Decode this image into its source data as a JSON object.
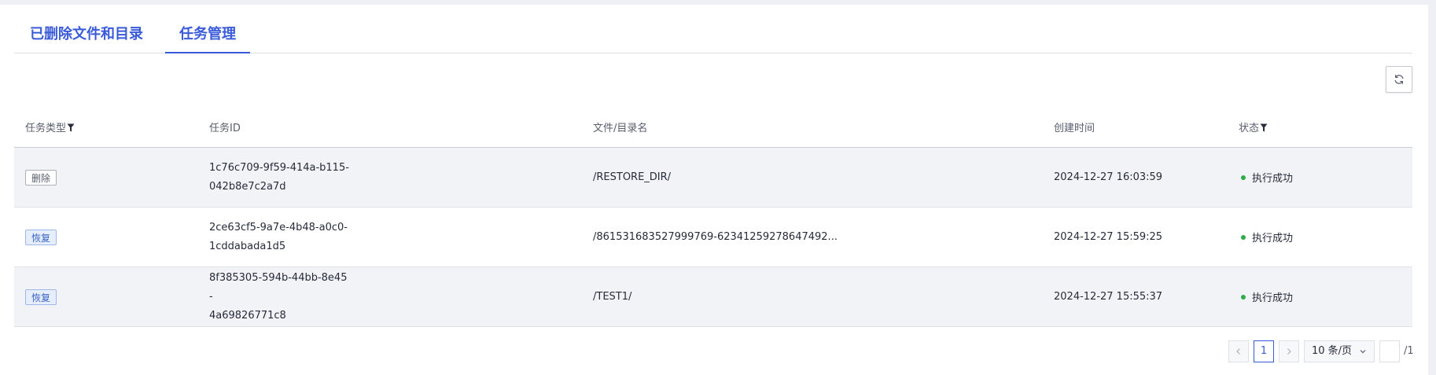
{
  "tabs": [
    {
      "label": "已删除文件和目录"
    },
    {
      "label": "任务管理"
    }
  ],
  "toolbar": {
    "refresh_icon": "refresh-icon"
  },
  "table": {
    "headers": {
      "task_type": "任务类型",
      "task_id": "任务ID",
      "file_name": "文件/目录名",
      "created_time": "创建时间",
      "status": "状态"
    },
    "rows": [
      {
        "type": "删除",
        "id_line1": "1c76c709-9f59-414a-b115-",
        "id_line2": "042b8e7c2a7d",
        "name": "/RESTORE_DIR/",
        "time": "2024-12-27 16:03:59",
        "status": "执行成功"
      },
      {
        "type": "恢复",
        "id_line1": "2ce63cf5-9a7e-4b48-a0c0-",
        "id_line2": "1cddabada1d5",
        "name": "/861531683527999769-62341259278647492...",
        "time": "2024-12-27 15:59:25",
        "status": "执行成功"
      },
      {
        "type": "恢复",
        "id_line1": "8f385305-594b-44bb-8e45-",
        "id_line2": "4a69826771c8",
        "name": "/TEST1/",
        "time": "2024-12-27 15:55:37",
        "status": "执行成功"
      }
    ]
  },
  "pagination": {
    "current_page": "1",
    "page_size": "10 条/页",
    "total_pages": "/1"
  },
  "colors": {
    "accent": "#3a5bd9",
    "success": "#2cad48",
    "row_alt": "#f2f3f6"
  }
}
